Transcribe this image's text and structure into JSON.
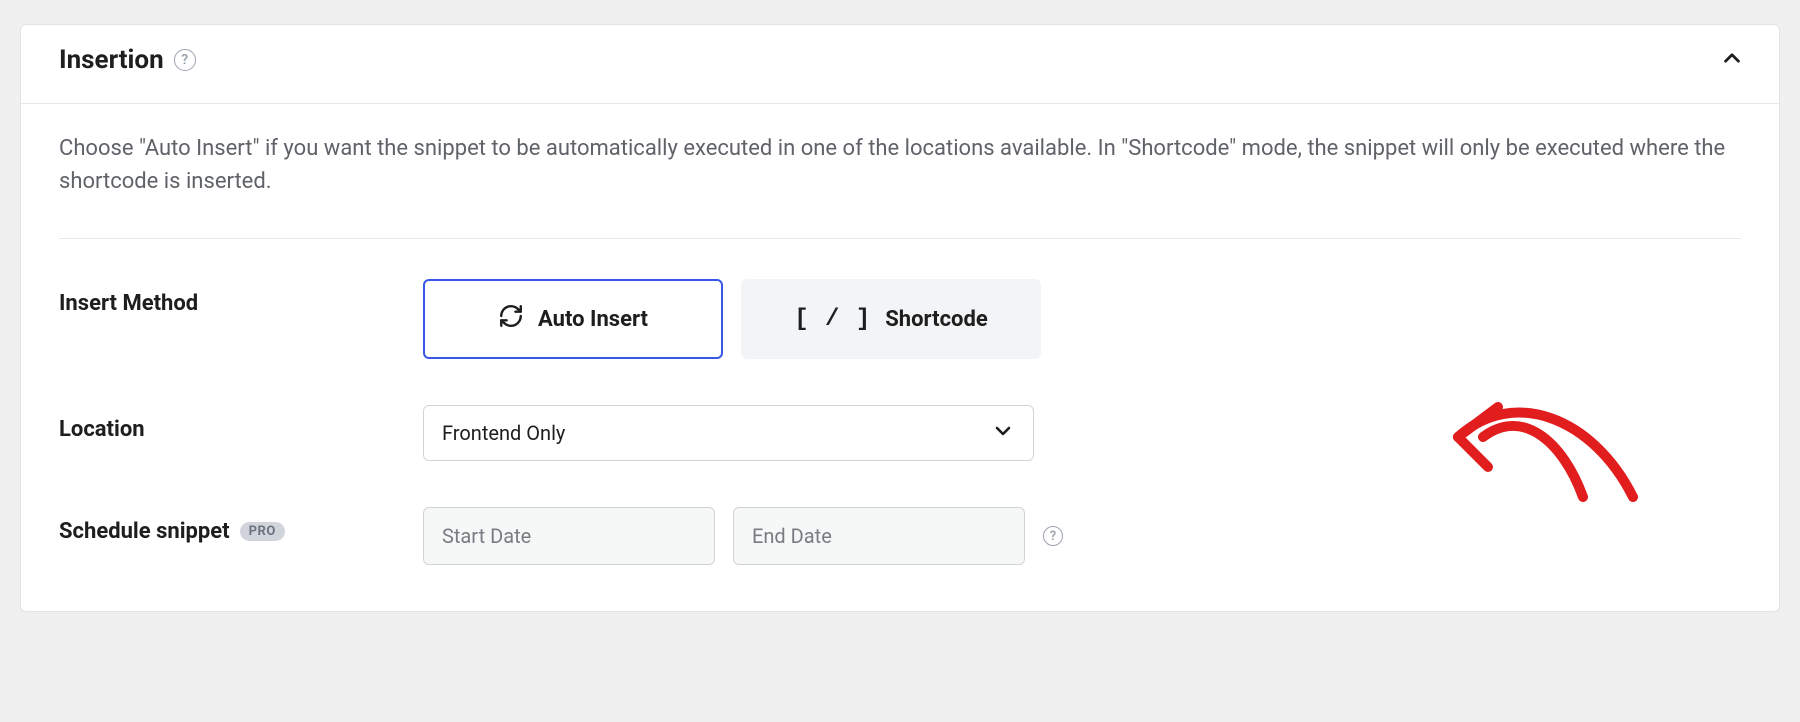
{
  "panel": {
    "title": "Insertion",
    "description": "Choose \"Auto Insert\" if you want the snippet to be automatically executed in one of the locations available. In \"Shortcode\" mode, the snippet will only be executed where the shortcode is inserted."
  },
  "insert_method": {
    "label": "Insert Method",
    "auto_insert_label": "Auto Insert",
    "shortcode_label": "Shortcode"
  },
  "location": {
    "label": "Location",
    "selected": "Frontend Only"
  },
  "schedule": {
    "label": "Schedule snippet",
    "badge": "Pro",
    "start_placeholder": "Start Date",
    "end_placeholder": "End Date"
  }
}
